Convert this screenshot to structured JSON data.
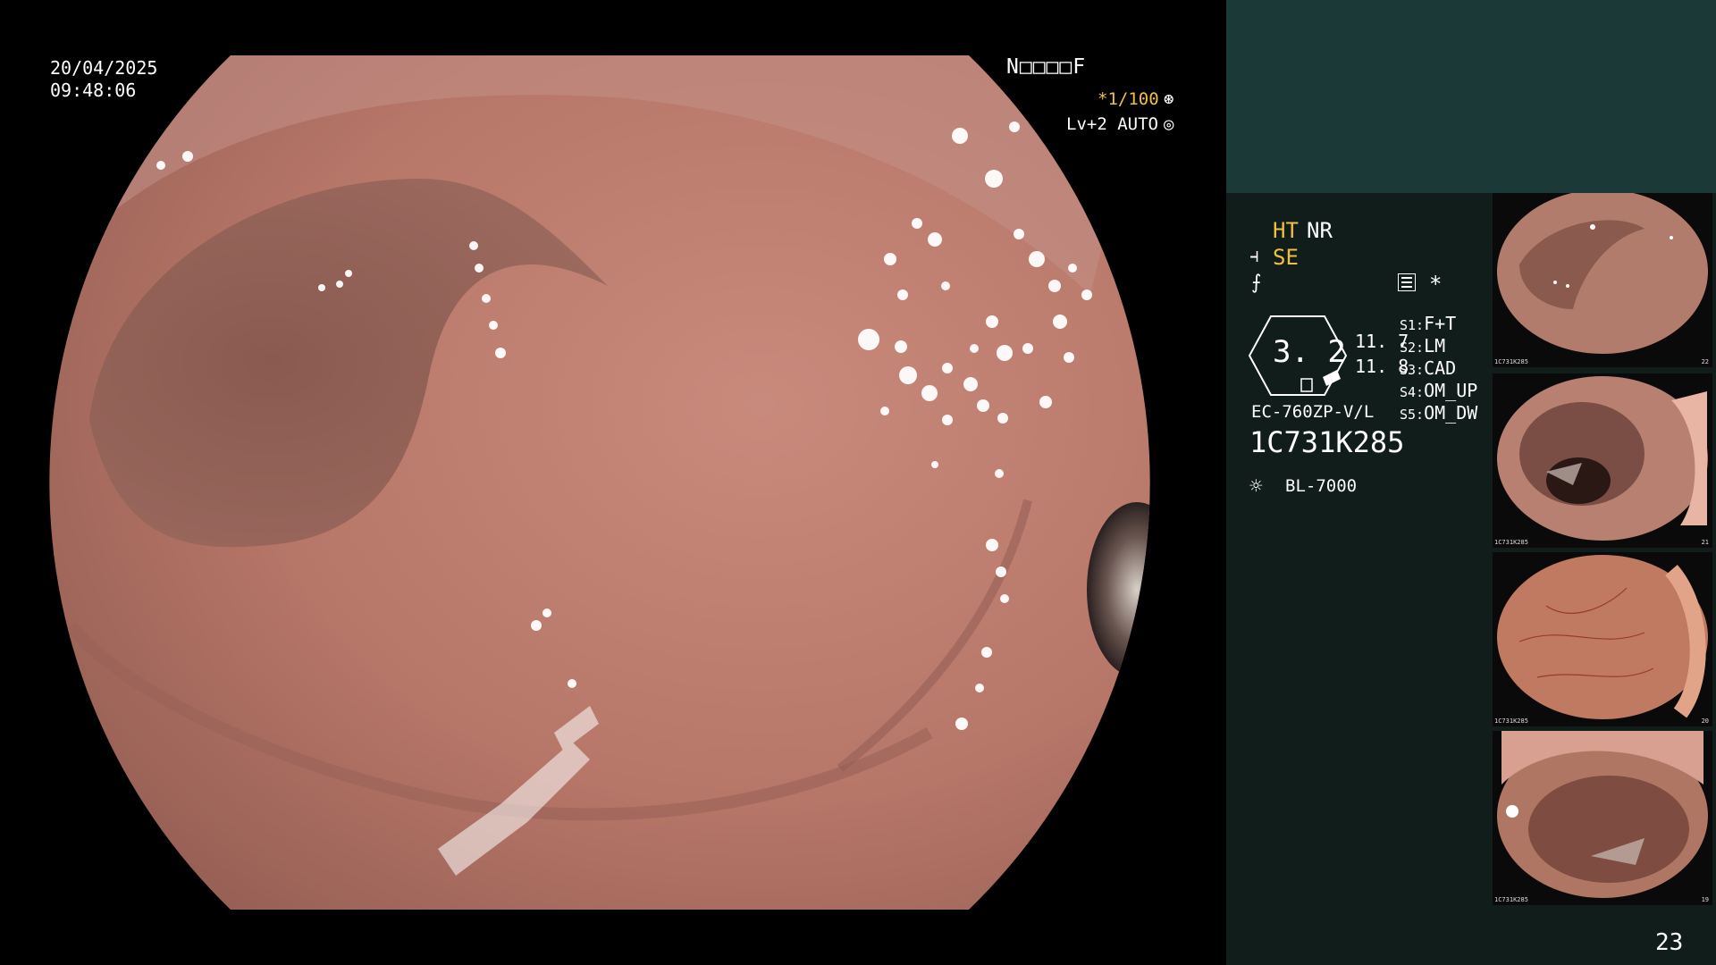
{
  "overlay": {
    "date": "20/04/2025",
    "time": "09:48:06",
    "patient_id": "N□□□□F",
    "shutter": "*1/100",
    "shutter_icon": "shutter-icon",
    "level": "Lv+2 AUTO",
    "level_icon": "auto-iris-icon"
  },
  "panel": {
    "ht": "HT",
    "nr": "NR",
    "se": "SE",
    "se_icon": "structure-enhancement-icon",
    "enh_icon": "edge-enhancement-icon",
    "star": "*",
    "ratio": "3. 2",
    "value1": "11. 7",
    "value2": "11. 8",
    "presets": [
      {
        "key": "S1:",
        "value": "F+T"
      },
      {
        "key": "S2:",
        "value": "LM"
      },
      {
        "key": "S3:",
        "value": "CAD"
      },
      {
        "key": "S4:",
        "value": "OM_UP"
      },
      {
        "key": "S5:",
        "value": "OM_DW"
      }
    ],
    "scope_model": "EC-760ZP-V/L",
    "serial": "1C731K285",
    "light_source": "BL-7000",
    "light_icon": "light-source-icon",
    "page_number": "23"
  },
  "thumbnails": [
    {
      "id": "1C731K285",
      "index": "22"
    },
    {
      "id": "1C731K285",
      "index": "21"
    },
    {
      "id": "1C731K285",
      "index": "20"
    },
    {
      "id": "1C731K285",
      "index": "19"
    }
  ],
  "colors": {
    "panel_bg": "#111d1a",
    "panel_top": "#1b3936",
    "accent_yellow": "#f0c040",
    "mucosa": "#b87a6e"
  }
}
